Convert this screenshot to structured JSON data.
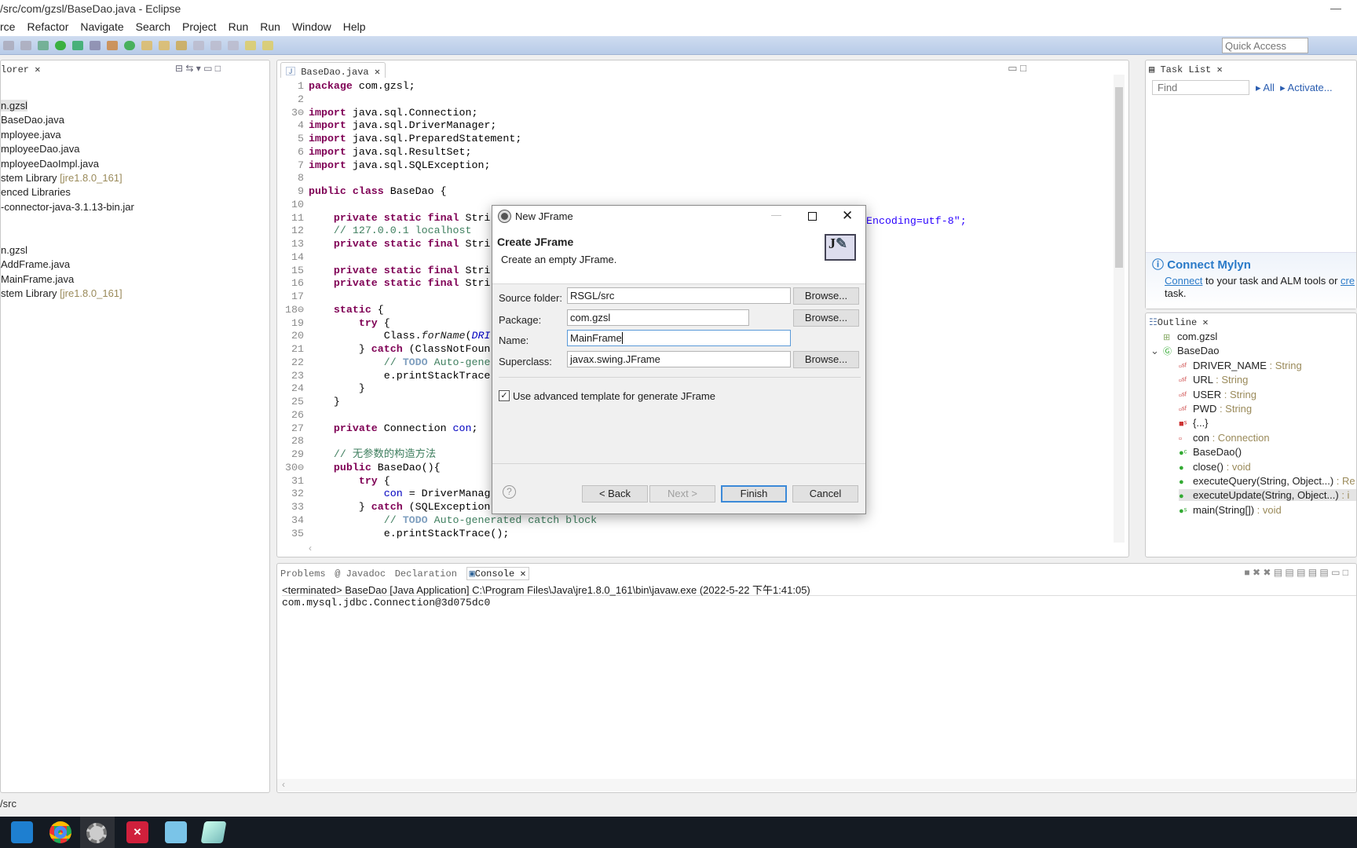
{
  "window": {
    "title": "/src/com/gzsl/BaseDao.java - Eclipse",
    "min": "—"
  },
  "menu": [
    "rce",
    "Refactor",
    "Navigate",
    "Search",
    "Project",
    "Run",
    "Run",
    "Window",
    "Help"
  ],
  "quick_access": {
    "placeholder": "Quick Access"
  },
  "explorer": {
    "tab": "lorer",
    "items": [
      {
        "t": "n.gzsl",
        "d": ""
      },
      {
        "t": "BaseDao.java",
        "d": ""
      },
      {
        "t": "mployee.java",
        "d": ""
      },
      {
        "t": "mployeeDao.java",
        "d": ""
      },
      {
        "t": "mployeeDaoImpl.java",
        "d": ""
      },
      {
        "t": "stem Library ",
        "d": "[jre1.8.0_161]"
      },
      {
        "t": "enced Libraries",
        "d": ""
      },
      {
        "t": "-connector-java-3.1.13-bin.jar",
        "d": ""
      },
      {
        "t": "",
        "d": ""
      },
      {
        "t": "",
        "d": ""
      },
      {
        "t": "n.gzsl",
        "d": ""
      },
      {
        "t": "AddFrame.java",
        "d": ""
      },
      {
        "t": "MainFrame.java",
        "d": ""
      },
      {
        "t": "stem Library ",
        "d": "[jre1.8.0_161]"
      }
    ]
  },
  "editor": {
    "tab": "BaseDao.java",
    "lines": [
      [
        1,
        [
          [
            "kw",
            "package"
          ],
          [
            "tx",
            " com.gzsl;"
          ]
        ]
      ],
      [
        2,
        []
      ],
      [
        "3⊖",
        [
          [
            "kw",
            "import"
          ],
          [
            "tx",
            " java.sql.Connection;"
          ]
        ]
      ],
      [
        4,
        [
          [
            "kw",
            "import"
          ],
          [
            "tx",
            " java.sql.DriverManager;"
          ]
        ]
      ],
      [
        5,
        [
          [
            "kw",
            "import"
          ],
          [
            "tx",
            " java.sql.PreparedStatement;"
          ]
        ]
      ],
      [
        6,
        [
          [
            "kw",
            "import"
          ],
          [
            "tx",
            " java.sql.ResultSet;"
          ]
        ]
      ],
      [
        7,
        [
          [
            "kw",
            "import"
          ],
          [
            "tx",
            " java.sql.SQLException;"
          ]
        ]
      ],
      [
        8,
        []
      ],
      [
        9,
        [
          [
            "kw",
            "public class"
          ],
          [
            "tx",
            " BaseDao {"
          ]
        ]
      ],
      [
        10,
        []
      ],
      [
        11,
        [
          [
            "tx",
            "    "
          ],
          [
            "kw",
            "private static final"
          ],
          [
            "tx",
            " Stri"
          ]
        ]
      ],
      [
        12,
        [
          [
            "cm",
            "    // 127.0.0.1 localhost"
          ]
        ]
      ],
      [
        13,
        [
          [
            "tx",
            "    "
          ],
          [
            "kw",
            "private static final"
          ],
          [
            "tx",
            " Stri"
          ]
        ]
      ],
      [
        14,
        []
      ],
      [
        15,
        [
          [
            "tx",
            "    "
          ],
          [
            "kw",
            "private static final"
          ],
          [
            "tx",
            " Stri"
          ]
        ]
      ],
      [
        16,
        [
          [
            "tx",
            "    "
          ],
          [
            "kw",
            "private static final"
          ],
          [
            "tx",
            " Stri"
          ]
        ]
      ],
      [
        17,
        []
      ],
      [
        "18⊖",
        [
          [
            "tx",
            "    "
          ],
          [
            "kw",
            "static"
          ],
          [
            "tx",
            " {"
          ]
        ]
      ],
      [
        19,
        [
          [
            "tx",
            "        "
          ],
          [
            "kw",
            "try"
          ],
          [
            "tx",
            " {"
          ]
        ]
      ],
      [
        20,
        [
          [
            "tx",
            "            Class."
          ],
          [
            "it",
            "forName"
          ],
          [
            "tx",
            "("
          ],
          [
            "fd it",
            "DRI"
          ]
        ]
      ],
      [
        21,
        [
          [
            "tx",
            "        } "
          ],
          [
            "kw",
            "catch"
          ],
          [
            "tx",
            " (ClassNotFoun"
          ]
        ]
      ],
      [
        22,
        [
          [
            "cm",
            "            // "
          ],
          [
            "cmk",
            "TODO"
          ],
          [
            "cm",
            " Auto-gene"
          ]
        ]
      ],
      [
        23,
        [
          [
            "tx",
            "            e.printStackTrace"
          ]
        ]
      ],
      [
        24,
        [
          [
            "tx",
            "        }"
          ]
        ]
      ],
      [
        25,
        [
          [
            "tx",
            "    }"
          ]
        ]
      ],
      [
        26,
        []
      ],
      [
        27,
        [
          [
            "tx",
            "    "
          ],
          [
            "kw",
            "private"
          ],
          [
            "tx",
            " Connection "
          ],
          [
            "fd",
            "con"
          ],
          [
            "tx",
            ";"
          ]
        ]
      ],
      [
        28,
        []
      ],
      [
        29,
        [
          [
            "cm",
            "    // 无参数的构造方法"
          ]
        ]
      ],
      [
        "30⊖",
        [
          [
            "tx",
            "    "
          ],
          [
            "kw",
            "public"
          ],
          [
            "tx",
            " BaseDao(){"
          ]
        ]
      ],
      [
        31,
        [
          [
            "tx",
            "        "
          ],
          [
            "kw",
            "try"
          ],
          [
            "tx",
            " {"
          ]
        ]
      ],
      [
        32,
        [
          [
            "tx",
            "            "
          ],
          [
            "fd",
            "con"
          ],
          [
            "tx",
            " = DriverManag"
          ]
        ]
      ],
      [
        33,
        [
          [
            "tx",
            "        } "
          ],
          [
            "kw",
            "catch"
          ],
          [
            "tx",
            " (SQLException"
          ]
        ]
      ],
      [
        34,
        [
          [
            "cm",
            "            // "
          ],
          [
            "cmk",
            "TODO"
          ],
          [
            "cm",
            " Auto-generated catch block"
          ]
        ]
      ],
      [
        35,
        [
          [
            "tx",
            "            e.printStackTrace();"
          ]
        ]
      ]
    ],
    "line13_tail": "Encoding=utf-8\";"
  },
  "tasklist": {
    "tab": "Task List",
    "find_placeholder": "Find",
    "all": "All",
    "activate": "Activate...",
    "mylyn_title": "Connect Mylyn",
    "mylyn_link": "Connect",
    "mylyn_text": " to your task and ALM tools or ",
    "mylyn_link2": "cre",
    "mylyn_text2": "task."
  },
  "outline": {
    "tab": "Outline",
    "items": [
      {
        "n": "com.gzsl",
        "t": "",
        "i": "package"
      },
      {
        "n": "BaseDao",
        "t": "",
        "i": "class"
      },
      {
        "n": "DRIVER_NAME",
        "t": " : String",
        "i": "field-sf"
      },
      {
        "n": "URL",
        "t": " : String",
        "i": "field-sf"
      },
      {
        "n": "USER",
        "t": " : String",
        "i": "field-sf"
      },
      {
        "n": "PWD",
        "t": " : String",
        "i": "field-sf"
      },
      {
        "n": "{...}",
        "t": "",
        "i": "static-init"
      },
      {
        "n": "con",
        "t": " : Connection",
        "i": "field"
      },
      {
        "n": "BaseDao()",
        "t": "",
        "i": "constructor"
      },
      {
        "n": "close()",
        "t": " : void",
        "i": "method"
      },
      {
        "n": "executeQuery(String, Object...)",
        "t": " : Re",
        "i": "method"
      },
      {
        "n": "executeUpdate(String, Object...)",
        "t": " : i",
        "i": "method"
      },
      {
        "n": "main(String[])",
        "t": " : void",
        "i": "method-static"
      }
    ]
  },
  "console": {
    "tabs": [
      "Problems",
      "Javadoc",
      "Declaration",
      "Console"
    ],
    "header": "<terminated> BaseDao [Java Application] C:\\Program Files\\Java\\jre1.8.0_161\\bin\\javaw.exe (2022-5-22 下午1:41:05)",
    "output": "com.mysql.jdbc.Connection@3d075dc0"
  },
  "status": {
    "text": "/src"
  },
  "taskbar": {
    "apps": [
      "vscode-icon",
      "chrome-icon",
      "eclipse-icon",
      "xmind-icon",
      "app-icon",
      "notepad-icon"
    ]
  },
  "dialog": {
    "title": "New JFrame",
    "heading": "Create JFrame",
    "description": "Create an empty JFrame.",
    "source_folder_label": "Source folder:",
    "source_folder": "RSGL/src",
    "package_label": "Package:",
    "package": "com.gzsl",
    "name_label": "Name:",
    "name": "MainFrame",
    "superclass_label": "Superclass:",
    "superclass": "javax.swing.JFrame",
    "browse": "Browse...",
    "advanced_label": "Use advanced template for generate JFrame",
    "advanced_checked": true,
    "back": "< Back",
    "next": "Next >",
    "finish": "Finish",
    "cancel": "Cancel"
  }
}
